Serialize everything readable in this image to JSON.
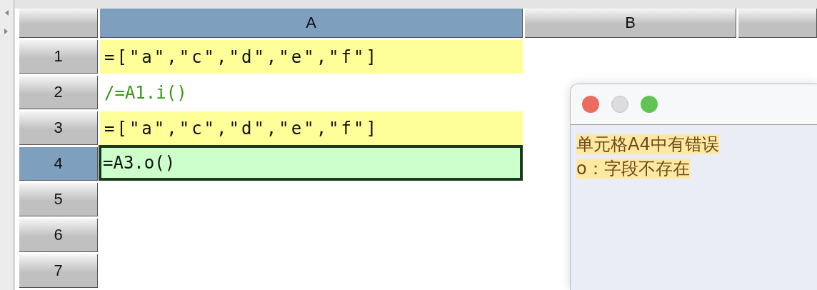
{
  "columns": [
    {
      "label": "A",
      "selected": true
    },
    {
      "label": "B",
      "selected": false
    }
  ],
  "rows": [
    {
      "number": "1",
      "selected": false,
      "cell": {
        "text": "=[\"a\",\"c\",\"d\",\"e\",\"f\"]",
        "kind": "constant"
      }
    },
    {
      "number": "2",
      "selected": false,
      "cell": {
        "text": "/=A1.i()",
        "kind": "comment"
      }
    },
    {
      "number": "3",
      "selected": false,
      "cell": {
        "text": "=[\"a\",\"c\",\"d\",\"e\",\"f\"]",
        "kind": "constant"
      }
    },
    {
      "number": "4",
      "selected": true,
      "cell": {
        "text": "=A3.o()",
        "kind": "formula"
      }
    },
    {
      "number": "5",
      "selected": false
    },
    {
      "number": "6",
      "selected": false
    },
    {
      "number": "7",
      "selected": false
    }
  ],
  "popup": {
    "messages": [
      "单元格A4中有错误",
      "o：字段不存在"
    ]
  }
}
